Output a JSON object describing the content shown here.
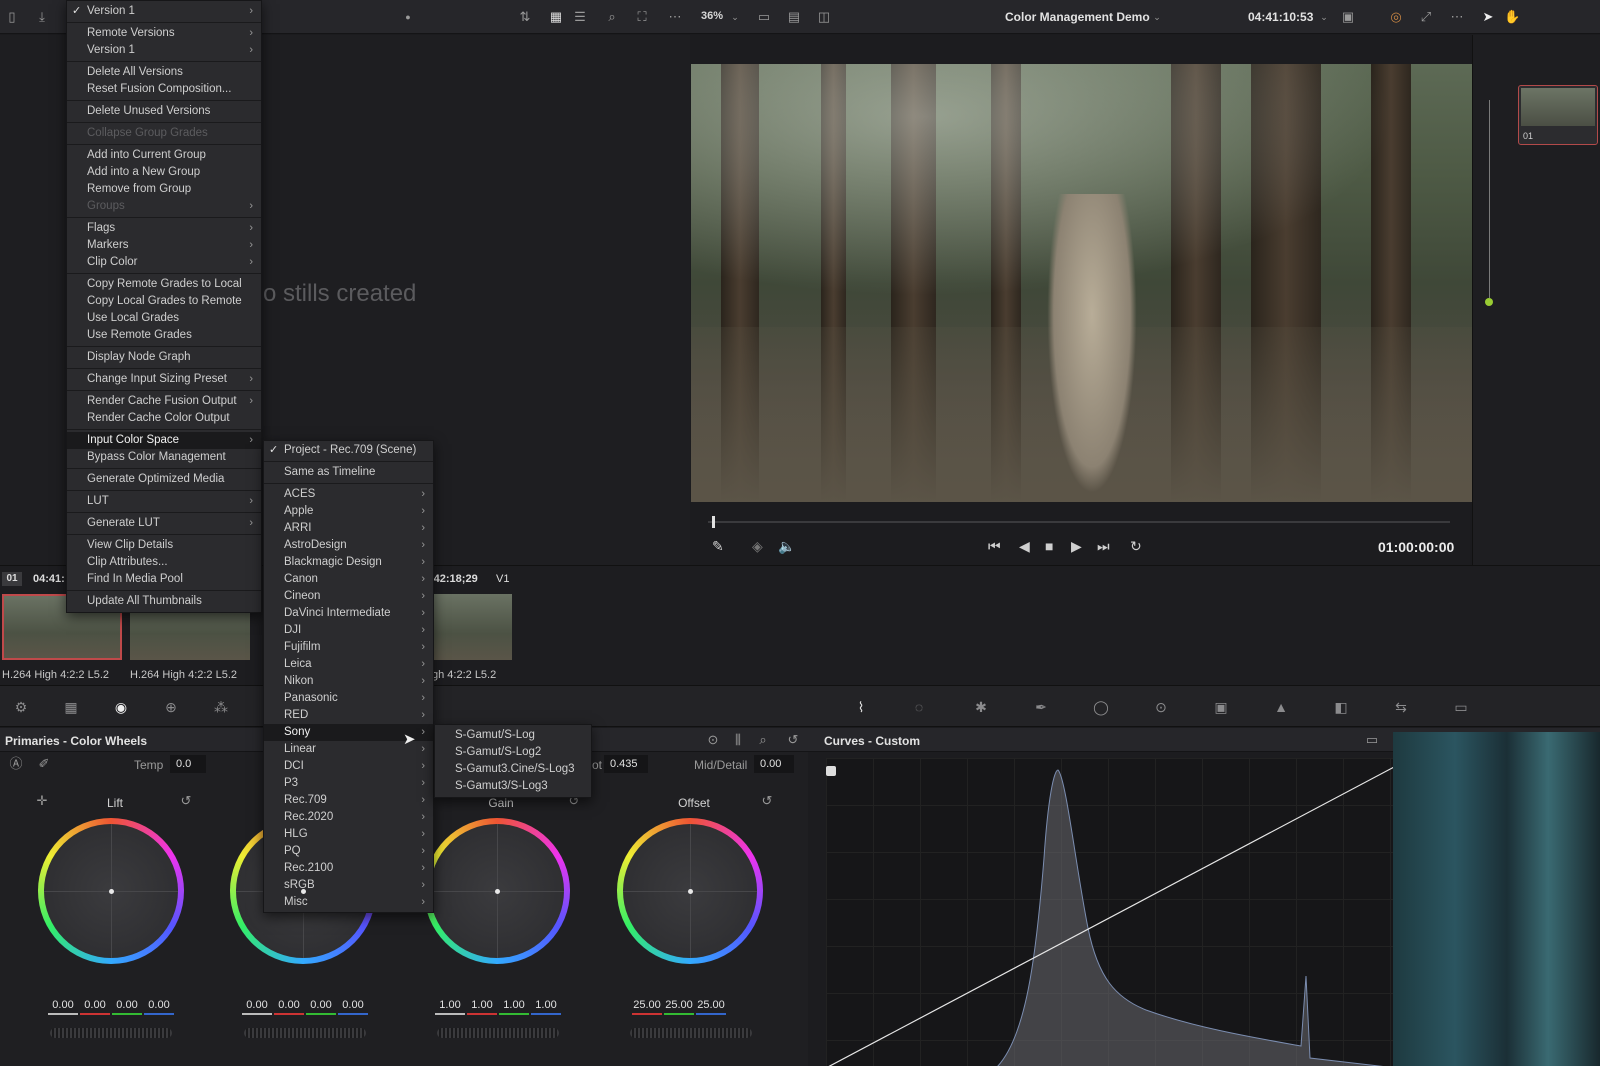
{
  "topbar": {
    "zoom": "36%",
    "project_name": "Color Management Demo",
    "timecode": "04:41:10:53"
  },
  "gallery": {
    "empty_text": "o stills created"
  },
  "viewer": {
    "timecode": "01:00:00:00"
  },
  "nodes": {
    "node_label": "01"
  },
  "timeline": {
    "clip_number": "01",
    "clip_tc_1": "04:41:",
    "clip_tc_2": ":42:18;29",
    "track": "V1",
    "codec_1": "H.264 High 4:2:2 L5.2",
    "codec_2": "H.264 High 4:2:2 L5.2",
    "codec_3": "gh 4:2:2 L5.2"
  },
  "primaries": {
    "title": "Primaries - Color Wheels",
    "temp_label": "Temp",
    "temp_value": "0.0",
    "pivot_label": "ot",
    "pivot_value": "0.435",
    "middetail_label": "Mid/Detail",
    "middetail_value": "0.00",
    "wheels": [
      {
        "name": "Lift",
        "values": [
          "0.00",
          "0.00",
          "0.00",
          "0.00"
        ]
      },
      {
        "name": "",
        "values": [
          "0.00",
          "0.00",
          "0.00",
          "0.00"
        ]
      },
      {
        "name": "Gain",
        "values": [
          "1.00",
          "1.00",
          "1.00",
          "1.00"
        ]
      },
      {
        "name": "Offset",
        "values": [
          "25.00",
          "25.00",
          "25.00"
        ]
      }
    ]
  },
  "curves": {
    "title": "Curves - Custom"
  },
  "context_menu": {
    "items": [
      "Version 1",
      "Remote Versions",
      "Version 1",
      "Delete All Versions",
      "Reset Fusion Composition...",
      "Delete Unused Versions",
      "Collapse Group Grades",
      "Add into Current Group",
      "Add into a New Group",
      "Remove from Group",
      "Groups",
      "Flags",
      "Markers",
      "Clip Color",
      "Copy Remote Grades to Local",
      "Copy Local Grades to Remote",
      "Use Local Grades",
      "Use Remote Grades",
      "Display Node Graph",
      "Change Input Sizing Preset",
      "Render Cache Fusion Output",
      "Render Cache Color Output",
      "Input Color Space",
      "Bypass Color Management",
      "Generate Optimized Media",
      "LUT",
      "Generate LUT",
      "View Clip Details",
      "Clip Attributes...",
      "Find In Media Pool",
      "Update All Thumbnails"
    ]
  },
  "colorspace_menu": {
    "items": [
      "Project - Rec.709 (Scene)",
      "Same as Timeline",
      "ACES",
      "Apple",
      "ARRI",
      "AstroDesign",
      "Blackmagic Design",
      "Canon",
      "Cineon",
      "DaVinci Intermediate",
      "DJI",
      "Fujifilm",
      "Leica",
      "Nikon",
      "Panasonic",
      "RED",
      "Sony",
      "Linear",
      "DCI",
      "P3",
      "Rec.709",
      "Rec.2020",
      "HLG",
      "PQ",
      "Rec.2100",
      "sRGB",
      "Misc"
    ]
  },
  "sony_menu": {
    "items": [
      "S-Gamut/S-Log",
      "S-Gamut/S-Log2",
      "S-Gamut3.Cine/S-Log3",
      "S-Gamut3/S-Log3"
    ]
  }
}
